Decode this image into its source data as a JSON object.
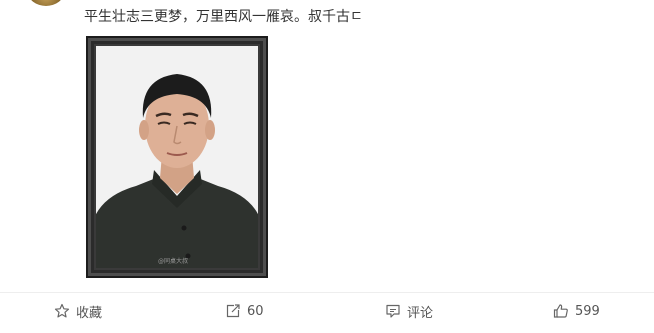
{
  "post": {
    "text": "平生壮志三更梦，万里西风一雁哀。叔千古",
    "text_end_glyph": "ㄷ",
    "image_watermark": "@同桌大叔"
  },
  "actions": {
    "favorite": {
      "label": "收藏",
      "icon": "star-icon"
    },
    "repost": {
      "count": "60",
      "icon": "repost-icon"
    },
    "comment": {
      "label": "评论",
      "icon": "comment-icon"
    },
    "like": {
      "count": "599",
      "icon": "thumbs-up-icon"
    }
  },
  "colors": {
    "text": "#333333",
    "action_text": "#555555",
    "frame": "#3a3a3a",
    "divider": "#eeeeee"
  }
}
